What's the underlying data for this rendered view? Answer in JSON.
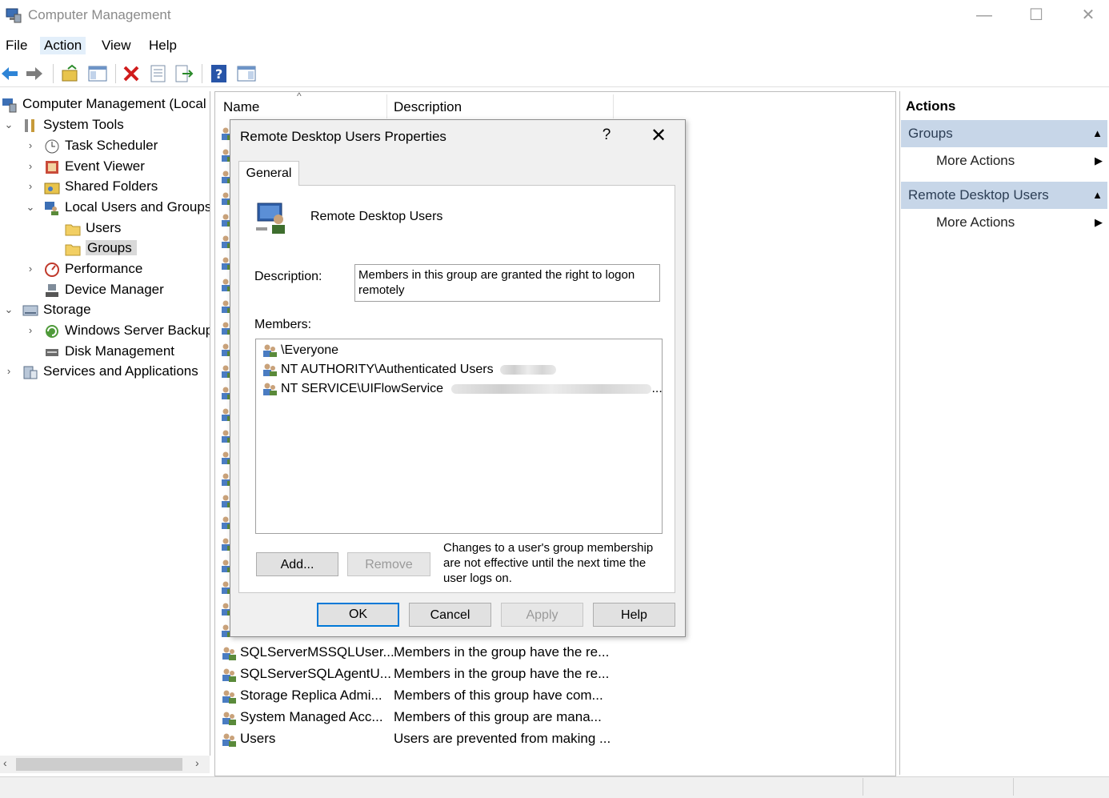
{
  "window": {
    "title": "Computer Management"
  },
  "menu": [
    "File",
    "Action",
    "View",
    "Help"
  ],
  "tree": [
    {
      "label": "Computer Management (Local",
      "icon": "computer-management-icon"
    },
    {
      "label": "System Tools",
      "icon": "tools-icon"
    },
    {
      "label": "Task Scheduler",
      "icon": "clock-icon"
    },
    {
      "label": "Event Viewer",
      "icon": "event-viewer-icon"
    },
    {
      "label": "Shared Folders",
      "icon": "shared-folder-icon"
    },
    {
      "label": "Local Users and Groups",
      "icon": "users-groups-icon"
    },
    {
      "label": "Users",
      "icon": "folder-icon"
    },
    {
      "label": "Groups",
      "icon": "folder-icon"
    },
    {
      "label": "Performance",
      "icon": "performance-icon"
    },
    {
      "label": "Device Manager",
      "icon": "device-manager-icon"
    },
    {
      "label": "Storage",
      "icon": "storage-icon"
    },
    {
      "label": "Windows Server Backup",
      "icon": "backup-icon"
    },
    {
      "label": "Disk Management",
      "icon": "disk-icon"
    },
    {
      "label": "Services and Applications",
      "icon": "services-icon"
    }
  ],
  "list": {
    "columns": {
      "name": "Name",
      "description": "Description"
    },
    "rows": [
      {
        "name": "SQLServerMSSQLUser...",
        "description": "Members in the group have the re..."
      },
      {
        "name": "SQLServerSQLAgentU...",
        "description": "Members in the group have the re..."
      },
      {
        "name": "Storage Replica Admi...",
        "description": "Members of this group have com..."
      },
      {
        "name": "System Managed Acc...",
        "description": "Members of this group are mana..."
      },
      {
        "name": "Users",
        "description": "Users are prevented from making ..."
      }
    ]
  },
  "actions": {
    "title": "Actions",
    "sections": [
      {
        "header": "Groups",
        "item": "More Actions"
      },
      {
        "header": "Remote Desktop Users",
        "item": "More Actions"
      }
    ]
  },
  "dialog": {
    "title": "Remote Desktop Users Properties",
    "help": "?",
    "close": "✕",
    "tab": "General",
    "group_name": "Remote Desktop Users",
    "description_label": "Description:",
    "description_value": "Members in this group are granted the right to logon remotely",
    "members_label": "Members:",
    "members": [
      "\\Everyone",
      "NT AUTHORITY\\Authenticated Users",
      "NT SERVICE\\UIFlowService"
    ],
    "members_overflow": "...",
    "add_label": "Add...",
    "remove_label": "Remove",
    "note": "Changes to a user's group membership are not effective until the next time the user logs on.",
    "ok_label": "OK",
    "cancel_label": "Cancel",
    "apply_label": "Apply",
    "help_label": "Help"
  },
  "colors": {
    "accent": "#0078d7",
    "selection": "#d9d9d9",
    "action_header": "#c7d6e8"
  }
}
